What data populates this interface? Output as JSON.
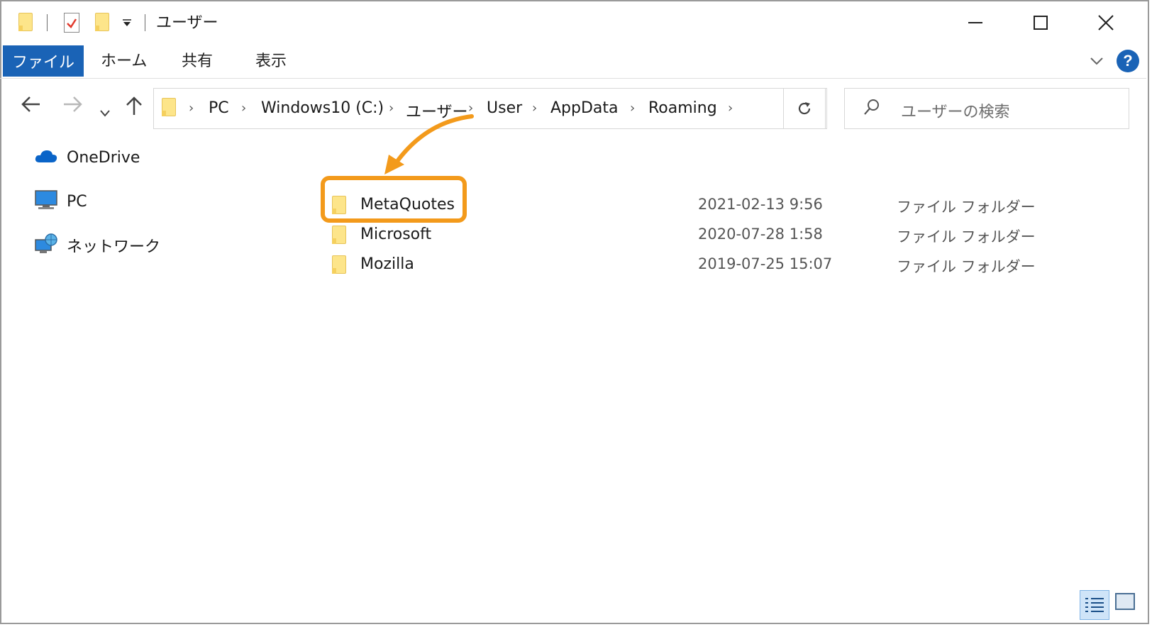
{
  "title": "ユーザー",
  "ribbon": {
    "tabs": [
      "ファイル",
      "ホーム",
      "共有",
      "表示"
    ]
  },
  "address": {
    "crumbs": [
      "PC",
      "Windows10 (C:)",
      "ユーザー",
      "User",
      "AppData",
      "Roaming"
    ]
  },
  "search": {
    "placeholder": "ユーザーの検索"
  },
  "sidebar": {
    "items": [
      {
        "label": "OneDrive",
        "icon": "onedrive-cloud-icon"
      },
      {
        "label": "PC",
        "icon": "pc-monitor-icon"
      },
      {
        "label": "ネットワーク",
        "icon": "network-icon"
      }
    ]
  },
  "files": [
    {
      "name": "MetaQuotes",
      "date": "2021-02-13 9:56",
      "type": "ファイル フォルダー",
      "highlighted": true
    },
    {
      "name": "Microsoft",
      "date": "2020-07-28 1:58",
      "type": "ファイル フォルダー",
      "highlighted": false
    },
    {
      "name": "Mozilla",
      "date": "2019-07-25 15:07",
      "type": "ファイル フォルダー",
      "highlighted": false
    }
  ],
  "colors": {
    "ribbon_file_tab": "#1a63b6",
    "highlight": "#f39a1b",
    "folder": "#fde58a",
    "help": "#1a63b6"
  }
}
